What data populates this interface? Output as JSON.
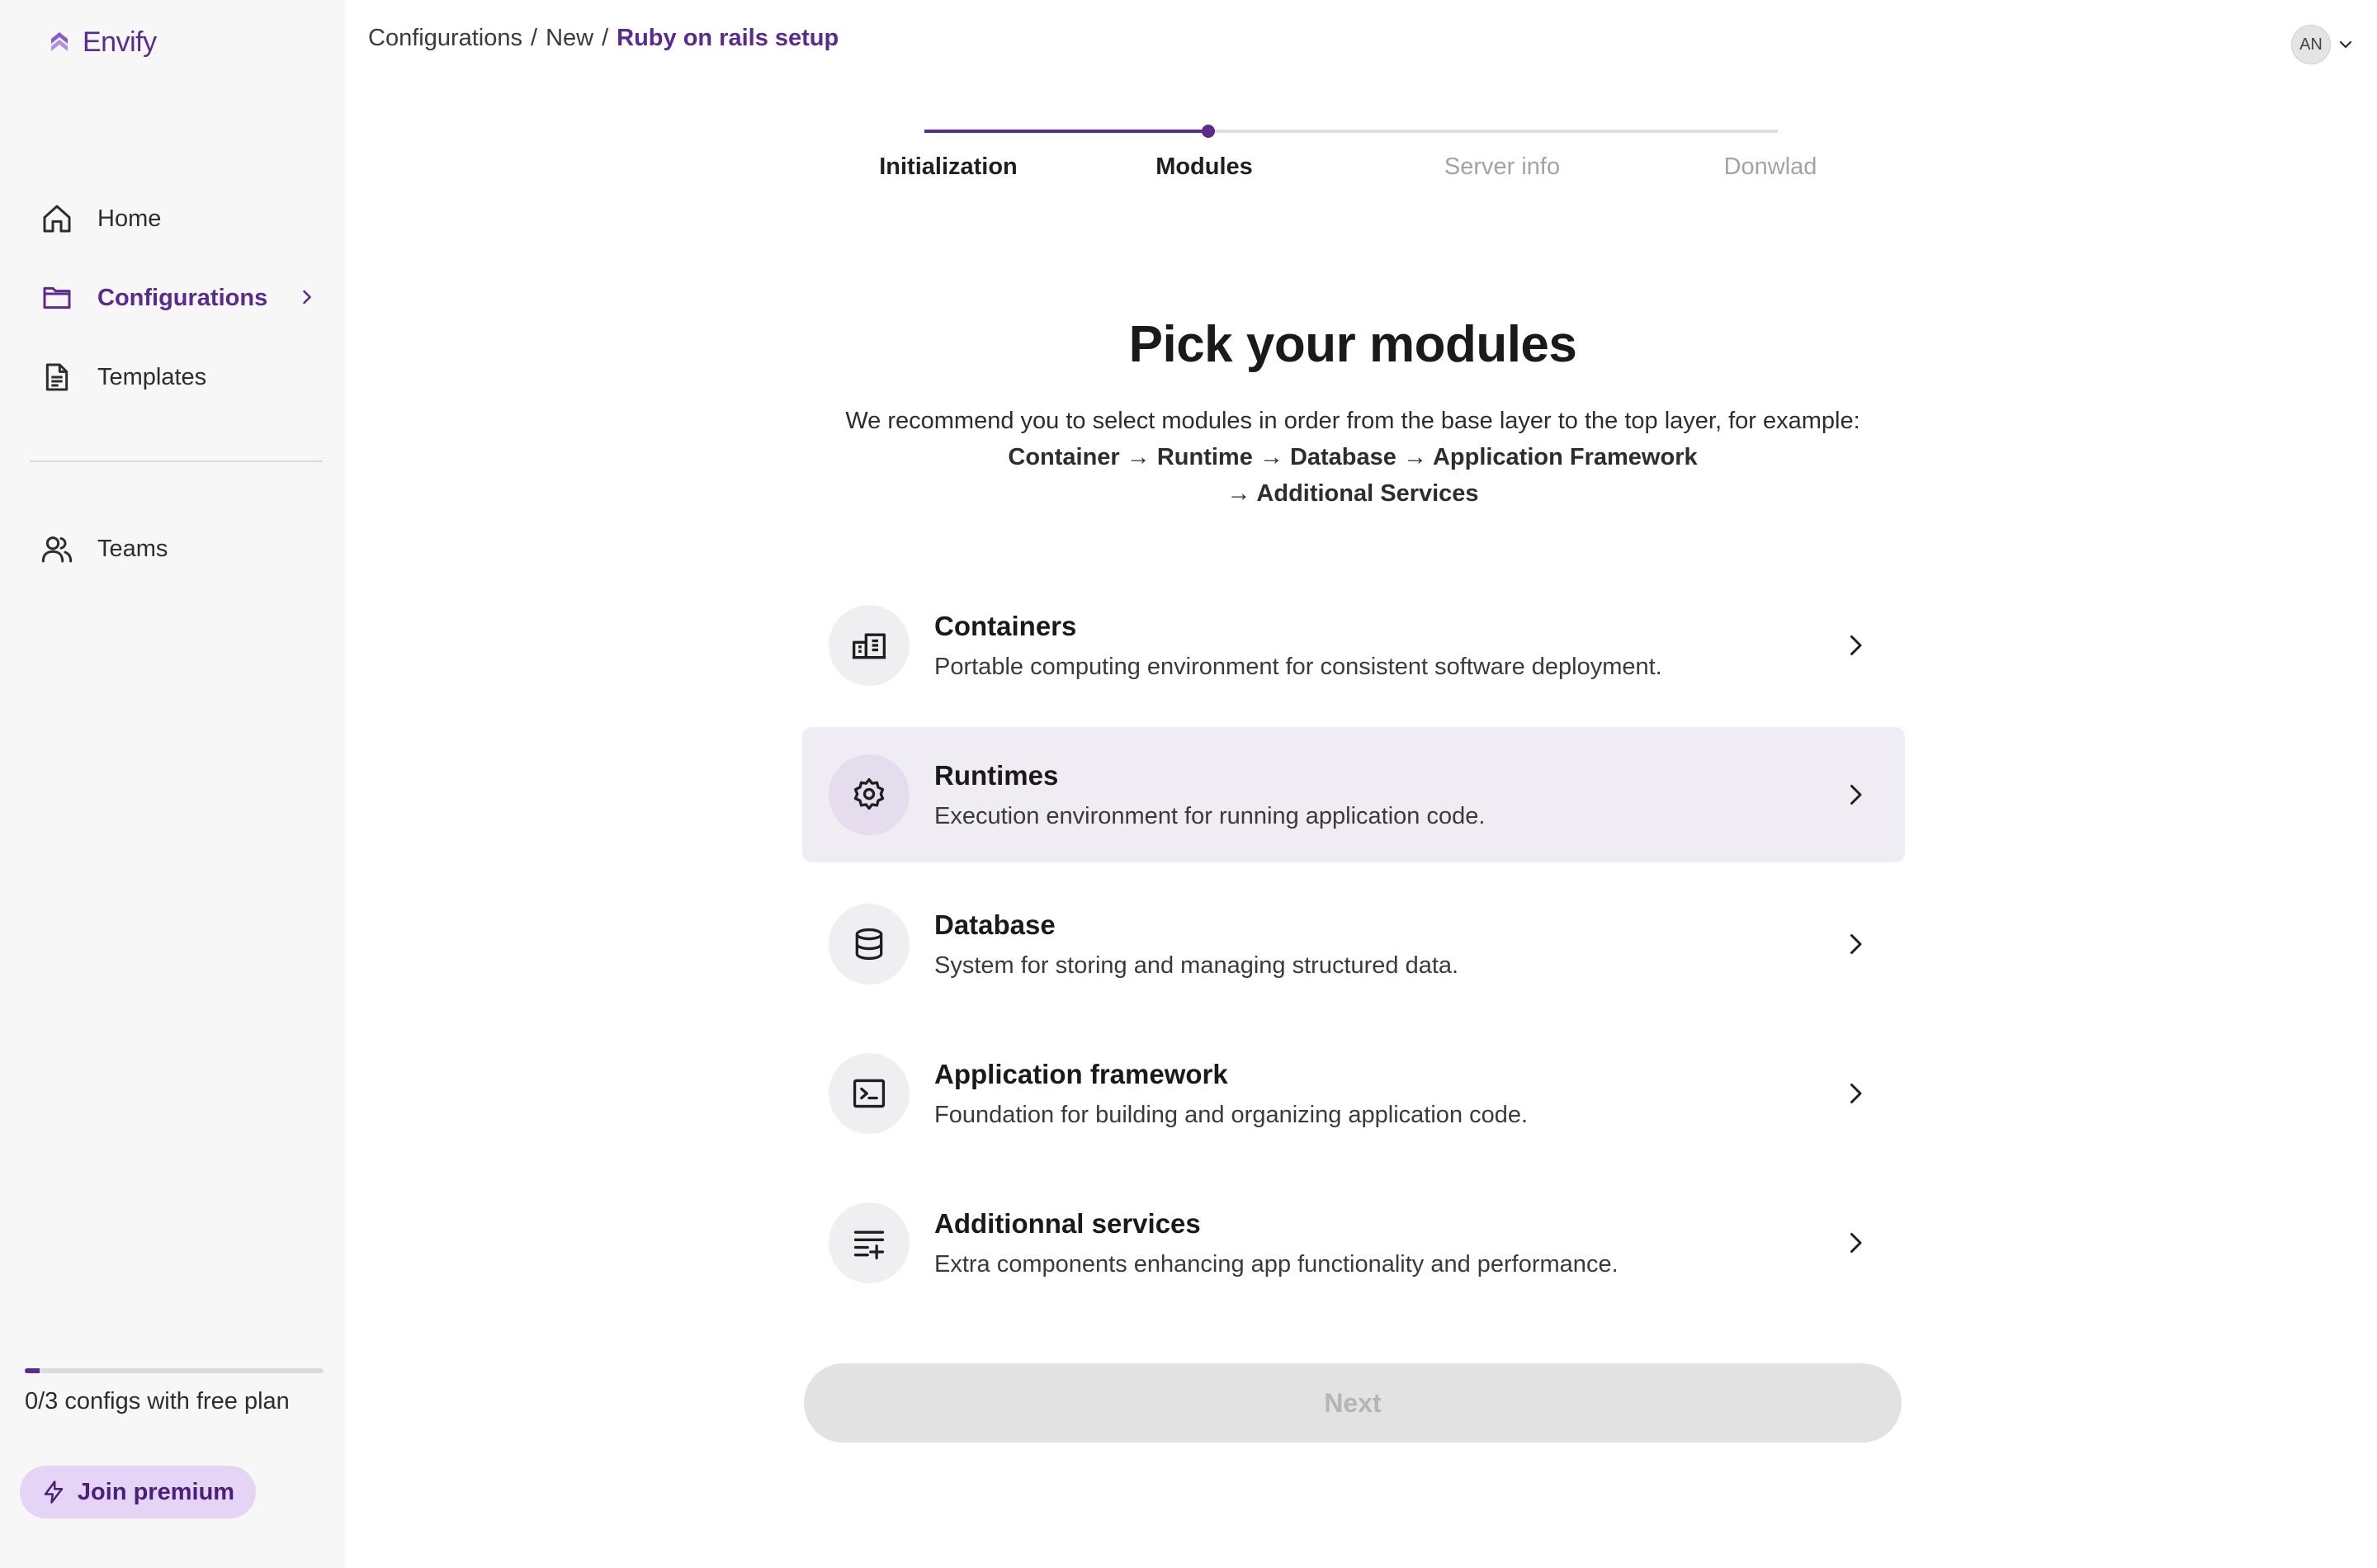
{
  "app": {
    "name": "Envify",
    "brand_color": "#5b2a8f"
  },
  "sidebar": {
    "items": [
      {
        "label": "Home",
        "icon": "home-icon",
        "active": false
      },
      {
        "label": "Configurations",
        "icon": "folder-icon",
        "active": true
      },
      {
        "label": "Templates",
        "icon": "document-icon",
        "active": false
      }
    ],
    "teams": {
      "label": "Teams",
      "icon": "users-icon"
    },
    "plan": {
      "text": "0/3 configs with free plan",
      "used": 0,
      "limit": 3,
      "progress_fraction": 0.05
    },
    "premium_button": {
      "label": "Join premium",
      "icon": "lightning-icon"
    }
  },
  "header": {
    "breadcrumb": {
      "items": [
        "Configurations",
        "New"
      ],
      "separator": "/",
      "current": "Ruby on rails setup"
    },
    "user": {
      "initials": "AN"
    }
  },
  "stepper": {
    "steps": [
      {
        "label": "Initialization",
        "status": "done"
      },
      {
        "label": "Modules",
        "status": "current"
      },
      {
        "label": "Server info",
        "status": "todo"
      },
      {
        "label": "Donwlad",
        "status": "todo"
      }
    ],
    "progress_fraction": 0.333
  },
  "main": {
    "title": "Pick your modules",
    "intro": "We recommend you to select modules in order from the base layer to the top layer, for example:",
    "flow_line1": "Container → Runtime → Database → Application Framework",
    "flow_line2": "→ Additional Services",
    "modules": [
      {
        "title": "Containers",
        "description": "Portable computing environment for consistent software deployment.",
        "icon": "containers-icon",
        "highlighted": false
      },
      {
        "title": "Runtimes",
        "description": "Execution environment for running application code.",
        "icon": "gear-icon",
        "highlighted": true
      },
      {
        "title": "Database",
        "description": "System for storing and managing structured data.",
        "icon": "database-icon",
        "highlighted": false
      },
      {
        "title": "Application framework",
        "description": "Foundation for building and organizing application code.",
        "icon": "terminal-icon",
        "highlighted": false
      },
      {
        "title": "Additionnal services",
        "description": "Extra components enhancing app functionality and performance.",
        "icon": "playlist-add-icon",
        "highlighted": false
      }
    ],
    "next_button": {
      "label": "Next",
      "disabled": true
    }
  }
}
